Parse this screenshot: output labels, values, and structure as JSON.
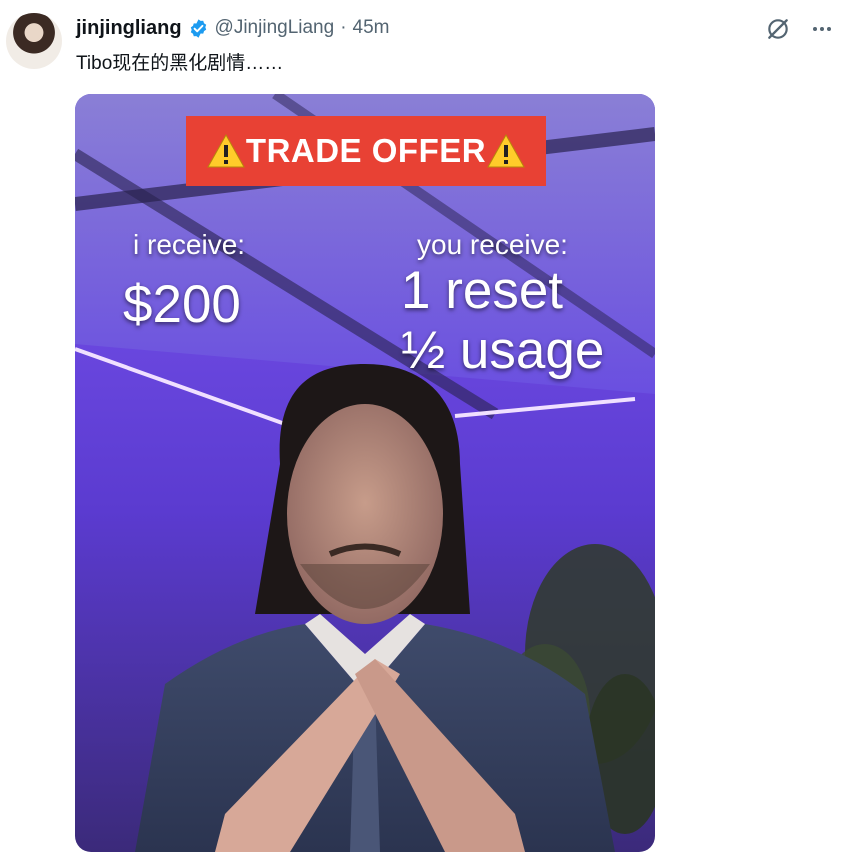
{
  "tweet": {
    "display_name": "jinjingliang",
    "handle": "@JinjingLiang",
    "separator": "·",
    "time": "45m",
    "text": "Tibo现在的黑化剧情……",
    "icons": {
      "verified": "verified-badge-icon",
      "grok": "grok-icon",
      "more": "more-icon"
    },
    "colors": {
      "verified": "#1d9bf0",
      "secondary_text": "#536471",
      "primary_text": "#0f1419"
    }
  },
  "media": {
    "meme": {
      "banner": "TRADE OFFER",
      "banner_color": "#e84134",
      "i_receive_label": "i receive:",
      "i_receive_value": "$200",
      "you_receive_label": "you receive:",
      "you_receive_line1": "1 reset",
      "you_receive_line2": "½ usage"
    },
    "image": "man-in-suit-purple-room"
  }
}
